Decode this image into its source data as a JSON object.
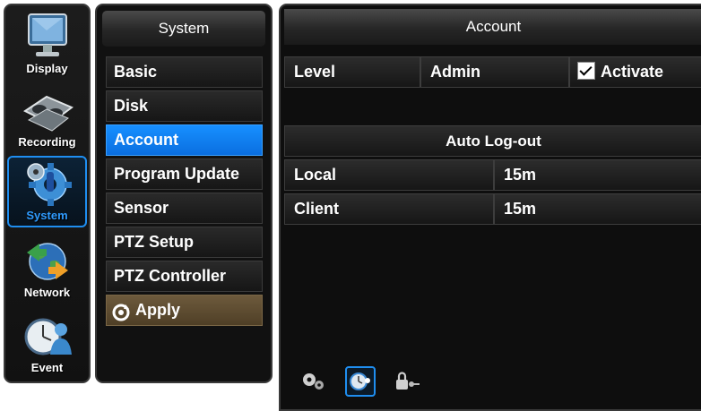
{
  "rail": {
    "items": [
      {
        "label": "Display",
        "icon": "monitor-icon"
      },
      {
        "label": "Recording",
        "icon": "tape-reels-icon"
      },
      {
        "label": "System",
        "icon": "gear-icon"
      },
      {
        "label": "Network",
        "icon": "globe-icon"
      },
      {
        "label": "Event",
        "icon": "clock-person-icon"
      }
    ],
    "active": "System"
  },
  "menu": {
    "title": "System",
    "items": [
      "Basic",
      "Disk",
      "Account",
      "Program Update",
      "Sensor",
      "PTZ Setup",
      "PTZ Controller"
    ],
    "active": "Account",
    "apply_label": "Apply"
  },
  "panel": {
    "title": "Account",
    "level_label": "Level",
    "level_value": "Admin",
    "activate_label": "Activate",
    "activate_checked": true,
    "auto_logout": {
      "title": "Auto Log-out",
      "rows": [
        {
          "label": "Local",
          "value": "15m"
        },
        {
          "label": "Client",
          "value": "15m"
        }
      ]
    },
    "tabs": [
      "gears-icon",
      "clock-user-icon",
      "lock-key-icon"
    ]
  },
  "colors": {
    "accent": "#1790ff",
    "apply": "#6d5a3c",
    "panel_bg": "#0e0e0e"
  }
}
